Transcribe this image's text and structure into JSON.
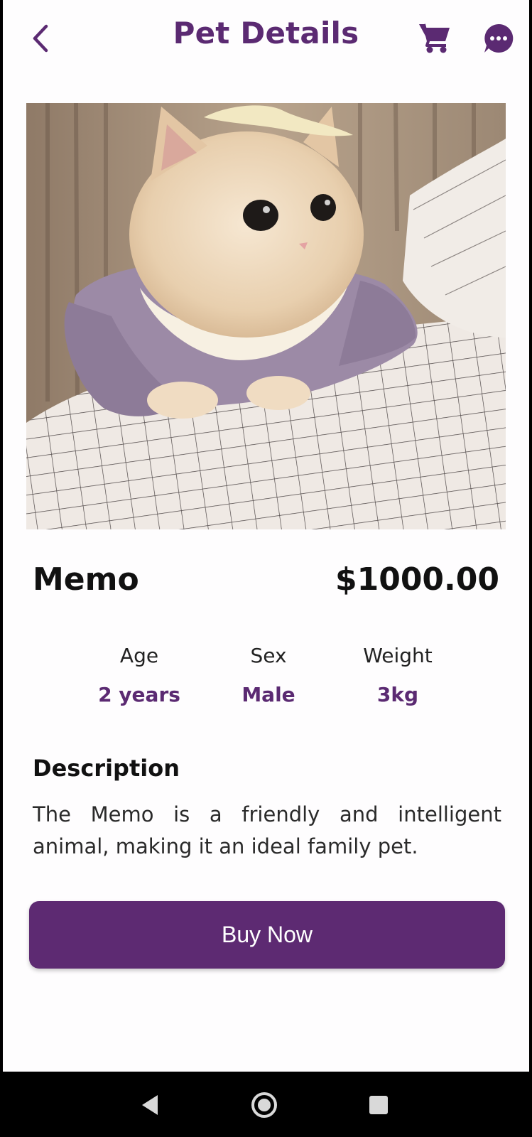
{
  "app_bar": {
    "title": "Pet Details",
    "back_icon": "chevron-left-icon",
    "cart_icon": "cart-icon",
    "chat_icon": "chat-bubble-icon"
  },
  "pet": {
    "name": "Memo",
    "price": "$1000.00",
    "photo_alt": "cream kitten in lavender dress on checked bedsheet"
  },
  "stats": [
    {
      "label": "Age",
      "value": "2 years"
    },
    {
      "label": "Sex",
      "value": "Male"
    },
    {
      "label": "Weight",
      "value": "3kg"
    }
  ],
  "description": {
    "title": "Description",
    "text": "The Memo is a friendly and intelligent animal, making it an ideal family pet."
  },
  "actions": {
    "buy_label": "Buy Now"
  },
  "system_nav": {
    "back_icon": "nav-back-icon",
    "home_icon": "nav-home-icon",
    "recents_icon": "nav-recents-icon"
  },
  "colors": {
    "accent": "#5b2a72",
    "button": "#5d2a72",
    "background": "#fefdfe"
  }
}
